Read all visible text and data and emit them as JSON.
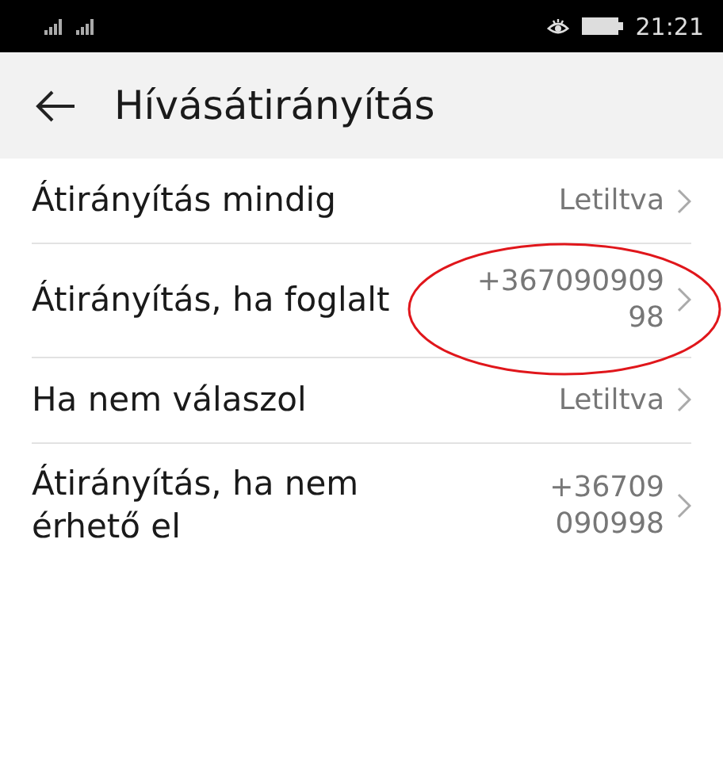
{
  "status_bar": {
    "time": "21:21"
  },
  "header": {
    "title": "Hívásátirányítás"
  },
  "rows": [
    {
      "label": "Átirányítás mindig",
      "value": "Letiltva",
      "kind": "short"
    },
    {
      "label": "Átirányítás, ha foglalt",
      "value": "+36709090998",
      "kind": "wide"
    },
    {
      "label": "Ha nem válaszol",
      "value": "Letiltva",
      "kind": "short"
    },
    {
      "label": "Átirányítás, ha nem érhető el",
      "value": "+36709090998",
      "kind": "narrow"
    }
  ]
}
